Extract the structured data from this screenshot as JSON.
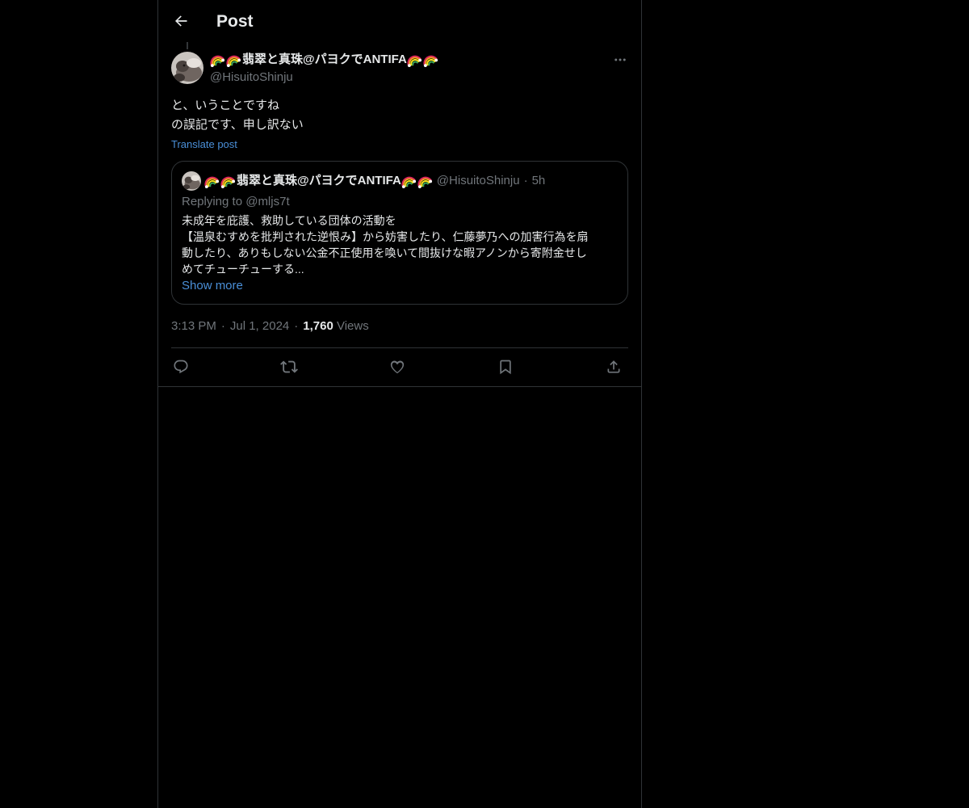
{
  "header": {
    "title": "Post"
  },
  "post": {
    "author": {
      "name": "翡翠と真珠@パヨクでANTIFA",
      "handle": "@HisuitoShinju",
      "name_decoration_icon": "rainbow-emoji"
    },
    "text_lines": [
      "と、いうことですね",
      "の誤記です、申し訳ない"
    ],
    "translate_label": "Translate post",
    "quote": {
      "author_name": "翡翠と真珠@パヨクでANTIFA",
      "author_handle": "@HisuitoShinju",
      "separator": "·",
      "time": "5h",
      "replying_to": "Replying to @mljs7t",
      "body_lines": [
        "未成年を庇護、救助している団体の活動を",
        "【温泉むすめを批判された逆恨み】から妨害したり、仁藤夢乃への加害行為を扇",
        "動したり、ありもしない公金不正使用を喚いて間抜けな暇アノンから寄附金せし",
        "めてチューチューする..."
      ],
      "show_more_label": "Show more"
    },
    "meta": {
      "time": "3:13 PM",
      "separator": "·",
      "date": "Jul 1, 2024",
      "views_count": "1,760",
      "views_label": "Views"
    }
  },
  "actions": [
    {
      "name": "reply",
      "icon": "reply-icon"
    },
    {
      "name": "repost",
      "icon": "repost-icon"
    },
    {
      "name": "like",
      "icon": "heart-icon"
    },
    {
      "name": "bookmark",
      "icon": "bookmark-icon"
    },
    {
      "name": "share",
      "icon": "share-icon"
    }
  ],
  "colors": {
    "background": "#000000",
    "text_primary": "#e7e9ea",
    "text_secondary": "#71767b",
    "link": "#4a8fd8",
    "border": "#2f3336"
  }
}
